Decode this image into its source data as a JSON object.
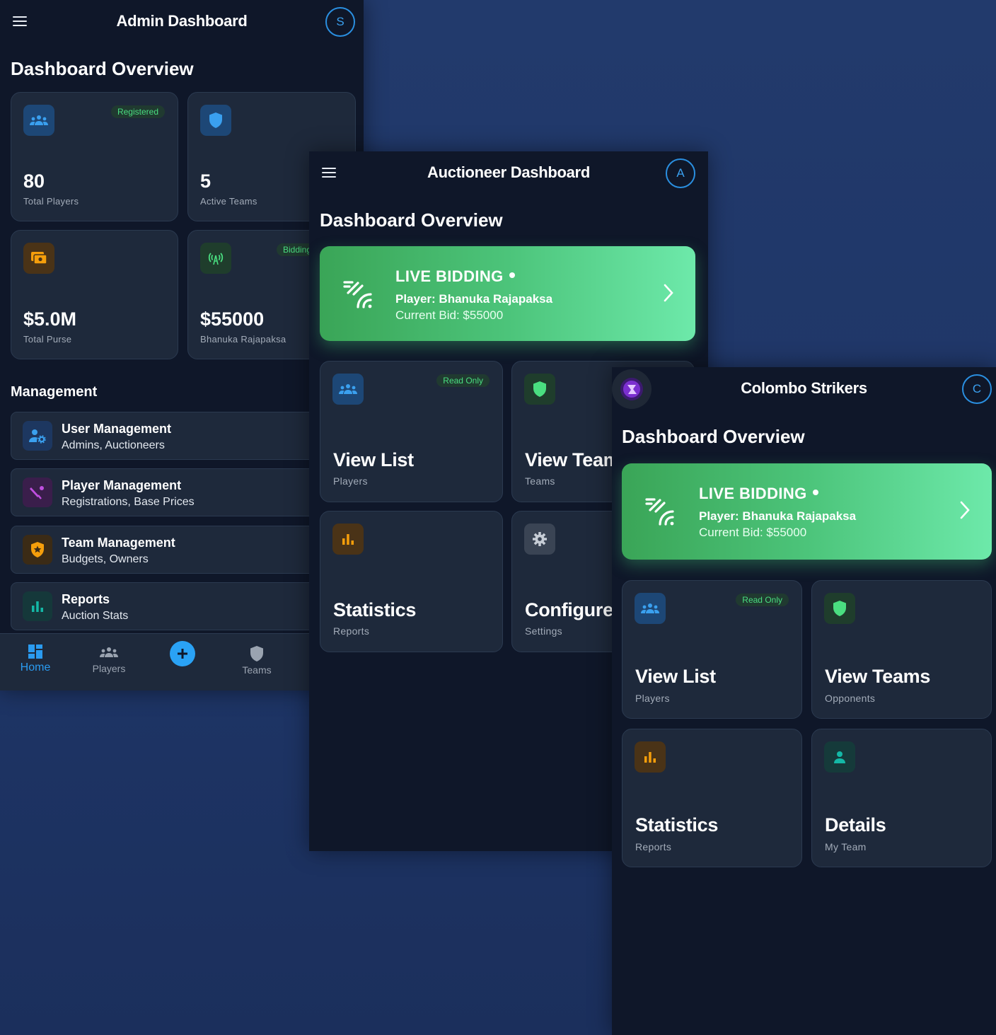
{
  "admin": {
    "title": "Admin Dashboard",
    "avatar": "S",
    "overview_title": "Dashboard Overview",
    "stats": [
      {
        "value": "80",
        "label": "Total Players",
        "badge": "Registered",
        "icon": "users-icon"
      },
      {
        "value": "5",
        "label": "Active Teams",
        "icon": "shield-icon"
      },
      {
        "value": "$5.0M",
        "label": "Total Purse",
        "icon": "wallet-icon"
      },
      {
        "value": "$55000",
        "label": "Bhanuka Rajapaksa",
        "badge": "Bidding",
        "icon": "broadcast-icon"
      }
    ],
    "management_title": "Management",
    "management": [
      {
        "title": "User Management",
        "subtitle": "Admins, Auctioneers",
        "icon": "user-cog-icon"
      },
      {
        "title": "Player Management",
        "subtitle": "Registrations, Base Prices",
        "icon": "cricket-icon"
      },
      {
        "title": "Team Management",
        "subtitle": "Budgets, Owners",
        "icon": "shield-star-icon"
      },
      {
        "title": "Reports",
        "subtitle": "Auction Stats",
        "icon": "bar-chart-icon"
      }
    ],
    "nav": [
      {
        "label": "Home",
        "icon": "dashboard-icon",
        "active": true
      },
      {
        "label": "Players",
        "icon": "users-icon"
      },
      {
        "label": "",
        "icon": "add-icon"
      },
      {
        "label": "Teams",
        "icon": "shield-icon"
      }
    ]
  },
  "auctioneer": {
    "title": "Auctioneer Dashboard",
    "avatar": "A",
    "overview_title": "Dashboard Overview",
    "live": {
      "title": "LIVE BIDDING",
      "player": "Player: Bhanuka Rajapaksa",
      "bid": "Current Bid: $55000"
    },
    "actions": [
      {
        "title": "View List",
        "subtitle": "Players",
        "badge": "Read Only",
        "icon": "users-icon"
      },
      {
        "title": "View Teams",
        "subtitle": "Teams",
        "icon": "shield-icon"
      },
      {
        "title": "Statistics",
        "subtitle": "Reports",
        "icon": "bar-chart-icon"
      },
      {
        "title": "Configure",
        "subtitle": "Settings",
        "icon": "gear-icon"
      }
    ]
  },
  "team": {
    "title": "Colombo Strikers",
    "avatar": "C",
    "overview_title": "Dashboard Overview",
    "live": {
      "title": "LIVE BIDDING",
      "player": "Player: Bhanuka Rajapaksa",
      "bid": "Current Bid: $55000"
    },
    "actions": [
      {
        "title": "View List",
        "subtitle": "Players",
        "badge": "Read Only",
        "icon": "users-icon"
      },
      {
        "title": "View Teams",
        "subtitle": "Opponents",
        "icon": "shield-icon"
      },
      {
        "title": "Statistics",
        "subtitle": "Reports",
        "icon": "bar-chart-icon"
      },
      {
        "title": "Details",
        "subtitle": "My Team",
        "icon": "person-icon"
      }
    ]
  },
  "colors": {
    "accent_blue": "#2a8fe0",
    "live_green": "#4cc47a",
    "badge_green": "#4ade80",
    "warning_orange": "#f59e0b"
  }
}
